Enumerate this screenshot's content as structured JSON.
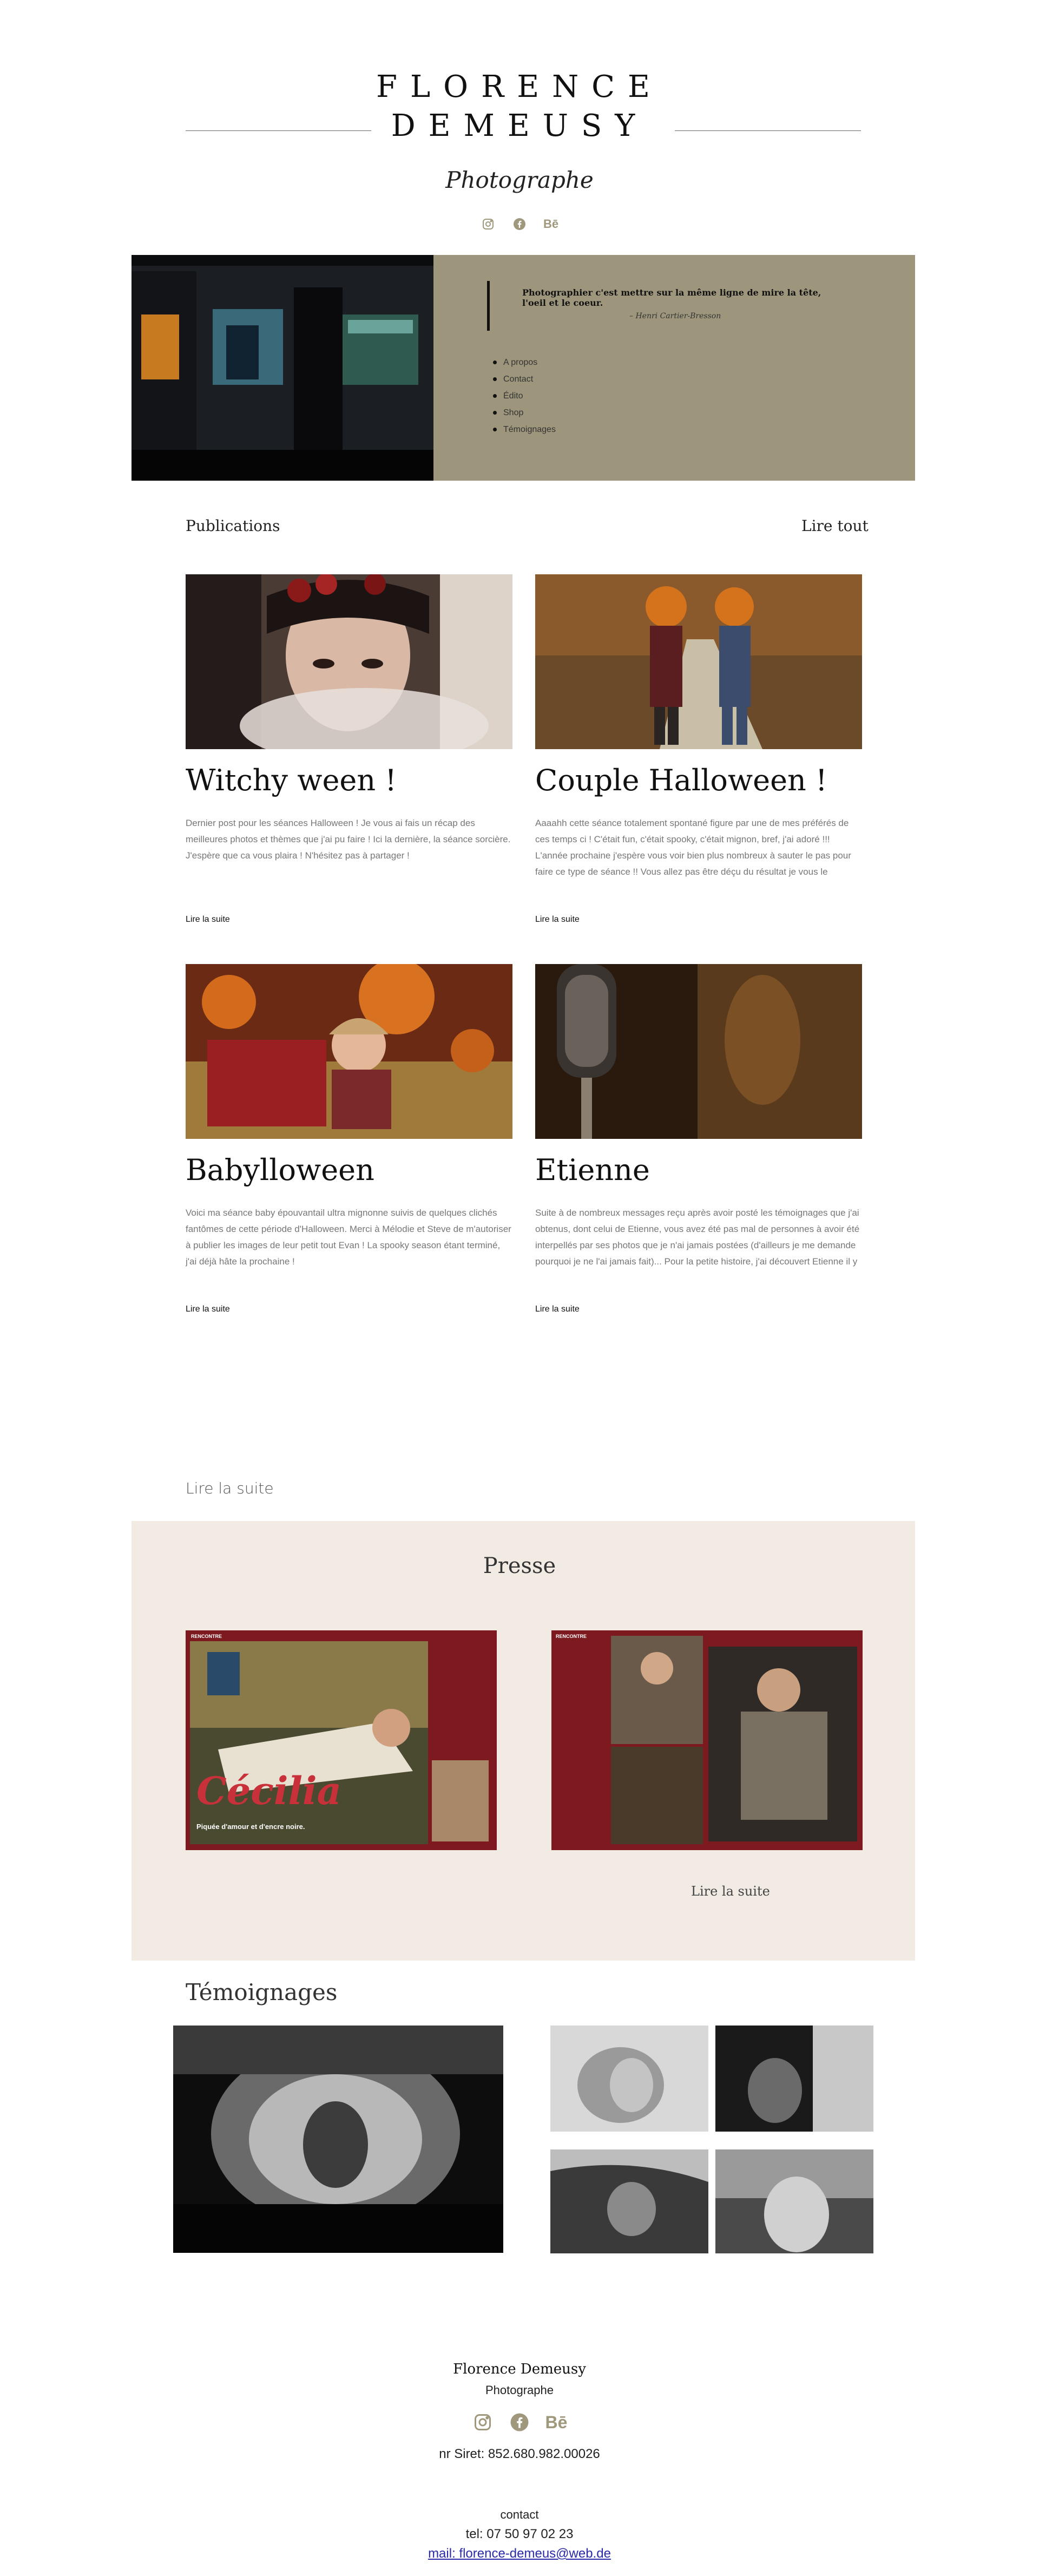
{
  "header": {
    "title_line1": "FLORENCE",
    "title_line2": "DEMEUSY",
    "subtitle": "Photographe",
    "socials": [
      "instagram-icon",
      "facebook-icon",
      "behance-icon"
    ],
    "behance_label": "Bē"
  },
  "hero": {
    "quote": "Photographier c'est mettre sur la même ligne de mire la tête, l'oeil et le coeur.",
    "author": "– Henri Cartier-Bresson",
    "nav": [
      "A propos",
      "Contact",
      "Édito",
      "Shop",
      "Témoignages"
    ]
  },
  "publications": {
    "heading": "Publications",
    "all_link": "Lire tout",
    "posts": [
      {
        "title": "Witchy ween !",
        "text": "Dernier post pour les séances Halloween ! Je vous ai fais un récap des meilleures photos et thèmes que j'ai pu faire ! Ici la dernière, la séance sorcière. J'espère que ca vous plaira ! N'hésitez pas à partager !",
        "more": "Lire la suite"
      },
      {
        "title": "Couple Halloween !",
        "text": "Aaaahh cette séance totalement spontané figure par une de mes préférés de ces temps ci ! C'était fun, c'était spooky, c'était mignon, bref, j'ai adoré !!! L'année prochaine j'espère vous voir bien plus nombreux à sauter le pas pour faire ce type de séance !! Vous allez pas être déçu du résultat je vous le garantie, il y a tellement de choses et",
        "more": "Lire la suite"
      },
      {
        "title": "Babylloween",
        "text": "Voici ma séance baby épouvantail ultra mignonne suivis de quelques clichés fantômes de cette période d'Halloween. Merci à Mélodie et Steve de m'autoriser à publier les images de leur petit tout Evan ! La spooky season étant terminé, j'ai déjà hâte la prochaine !",
        "more": "Lire la suite"
      },
      {
        "title": "Etienne",
        "text": "Suite à de nombreux messages reçu après avoir posté les témoignages que j'ai obtenus, dont celui de Etienne, vous avez été pas mal de personnes à avoir été interpellés par ses photos que je n'ai jamais postées (d'ailleurs je me demande pourquoi je ne l'ai jamais fait)... Pour la petite histoire, j'ai découvert Etienne il y à déjà de nombreuses",
        "more": "Lire la suite"
      }
    ],
    "bottom_more": "Lire la suite"
  },
  "presse": {
    "title": "Presse",
    "mag1_title": "Cécilia",
    "mag1_caption": "Piquée d'amour et d'encre noire.",
    "mag_tag": "RENCONTRE",
    "more": "Lire la suite"
  },
  "temoignages": {
    "title": "Témoignages"
  },
  "footer": {
    "name": "Florence Demeusy",
    "role": "Photographe",
    "siret": "nr Siret: 852.680.982.00026",
    "contact": "contact",
    "tel": "tel: 07 50 97 02 23",
    "mail": "mail: florence-demeus@web.de"
  },
  "colors": {
    "hero_bg": "#9d967c",
    "presse_bg": "#f1ebe4",
    "social_icon": "#a0987d",
    "link_blue": "#2a2aa8"
  }
}
